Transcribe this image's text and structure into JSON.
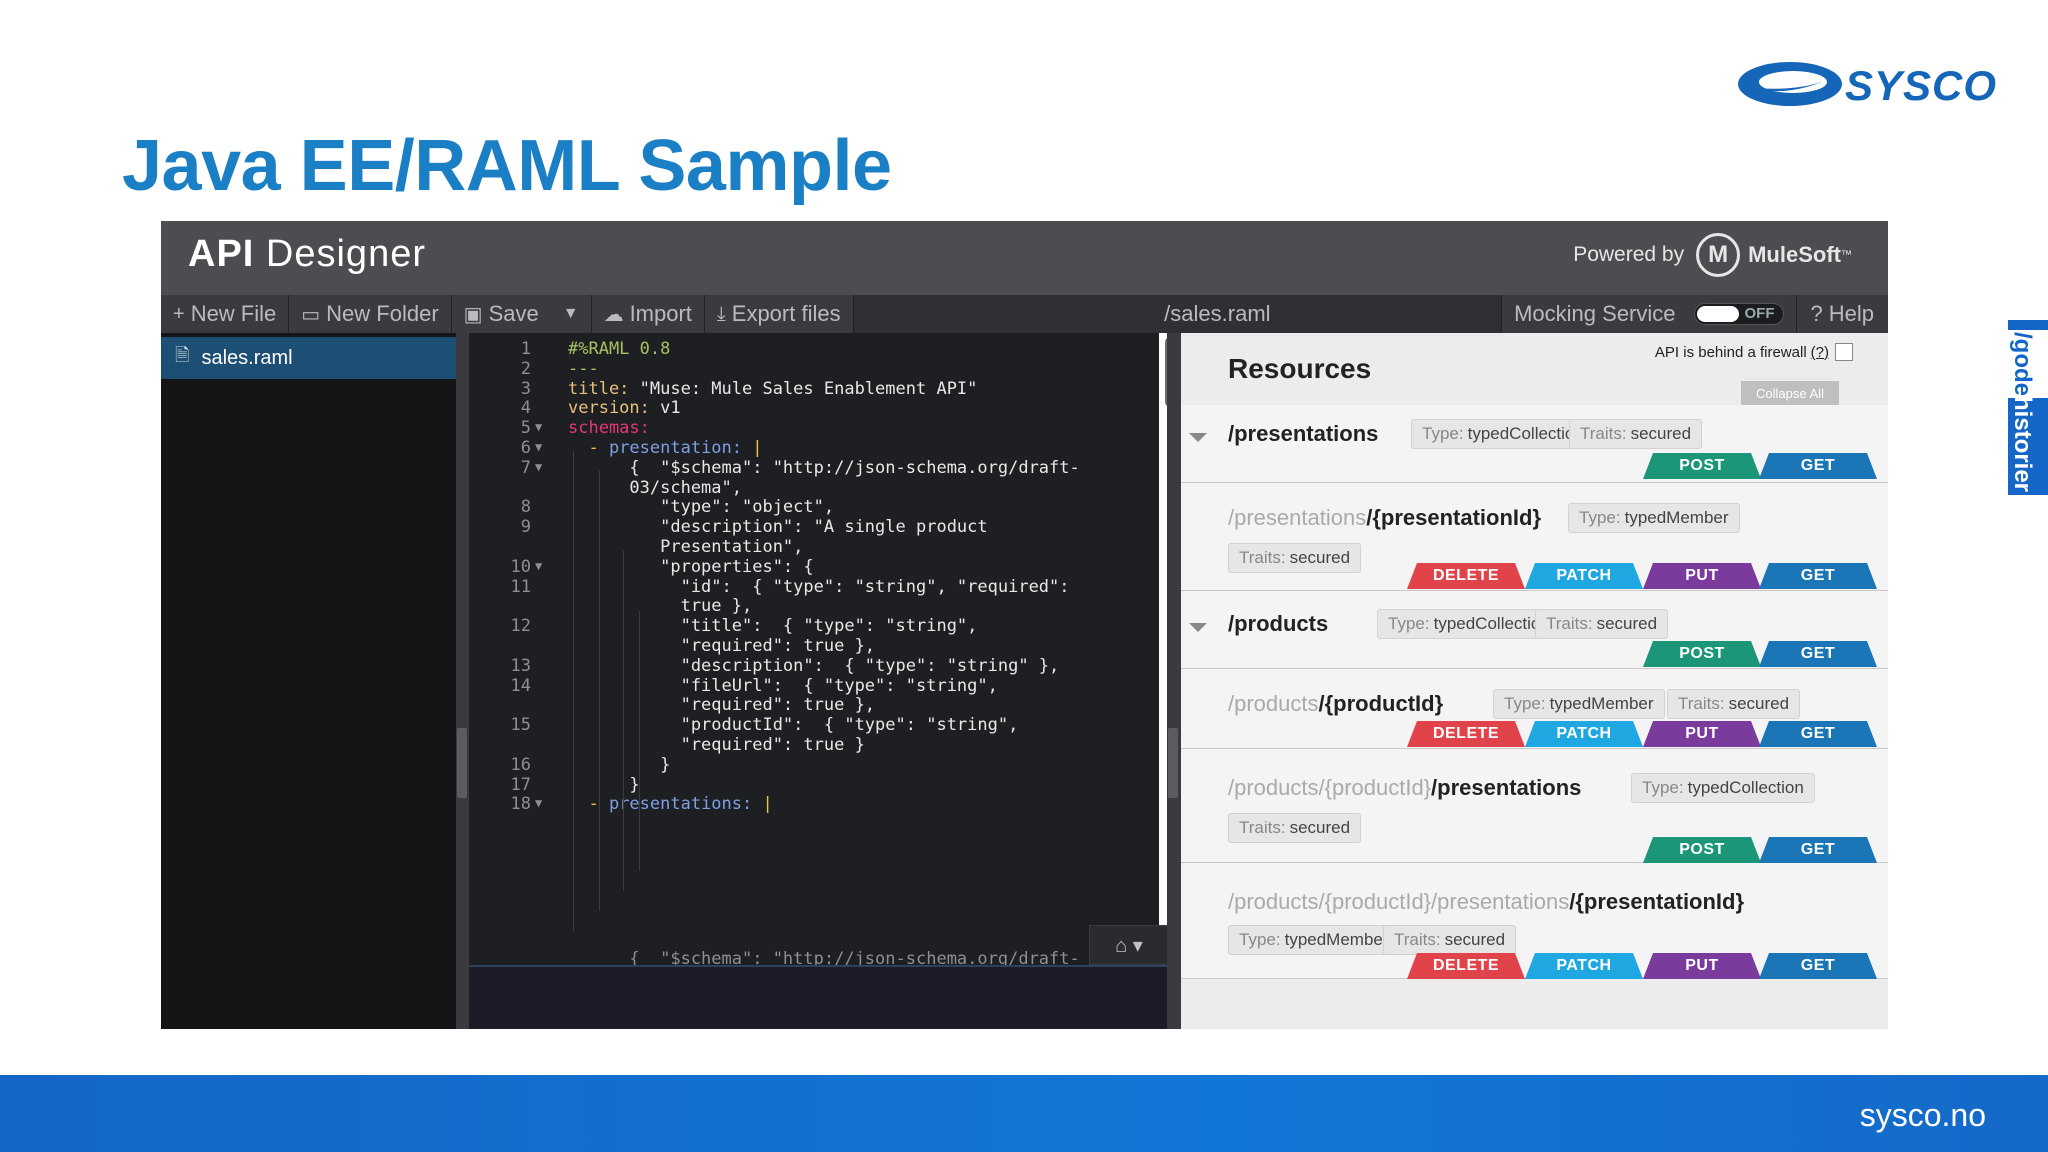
{
  "slide": {
    "title": "Java EE/RAML Sample",
    "logo_text": "SYSCO",
    "footer_url": "sysco.no",
    "side_tab": {
      "part1": "/gode",
      "part2": "historier"
    }
  },
  "app": {
    "title_bold": "API",
    "title_rest": " Designer",
    "powered_by": "Powered by",
    "brand": "MuleSoft",
    "brand_tm": "™"
  },
  "toolbar": {
    "new_file": "New File",
    "new_folder": "New Folder",
    "save": "Save",
    "import": "Import",
    "export": "Export files",
    "path": "/sales.raml",
    "mocking": "Mocking Service",
    "toggle": "OFF",
    "help": "Help"
  },
  "files": [
    {
      "name": "sales.raml"
    }
  ],
  "editor": {
    "lines": [
      {
        "n": "1",
        "fold": "",
        "parts": [
          [
            "meta",
            "#%RAML 0.8"
          ]
        ]
      },
      {
        "n": "2",
        "fold": "",
        "parts": [
          [
            "meta",
            "---"
          ]
        ]
      },
      {
        "n": "3",
        "fold": "",
        "parts": [
          [
            "key",
            "title: "
          ],
          [
            "str",
            "\"Muse: Mule Sales Enablement API\""
          ]
        ]
      },
      {
        "n": "4",
        "fold": "",
        "parts": [
          [
            "key",
            "version: "
          ],
          [
            "str",
            "v1"
          ]
        ]
      },
      {
        "n": "5",
        "fold": "▼",
        "parts": [
          [
            "pink",
            "schemas:"
          ]
        ]
      },
      {
        "n": "6",
        "fold": "▼",
        "parts": [
          [
            "bar",
            "  - "
          ],
          [
            "blue",
            "presentation: "
          ],
          [
            "bar",
            "|"
          ]
        ]
      },
      {
        "n": "7",
        "fold": "▼",
        "parts": [
          [
            "str",
            "      {  \"$schema\": \"http://json-schema.org/draft-"
          ]
        ]
      },
      {
        "n": "",
        "fold": "",
        "parts": [
          [
            "str",
            "      03/schema\","
          ]
        ]
      },
      {
        "n": "8",
        "fold": "",
        "parts": [
          [
            "str",
            "         \"type\": \"object\","
          ]
        ]
      },
      {
        "n": "9",
        "fold": "",
        "parts": [
          [
            "str",
            "         \"description\": \"A single product"
          ]
        ]
      },
      {
        "n": "",
        "fold": "",
        "parts": [
          [
            "str",
            "         Presentation\","
          ]
        ]
      },
      {
        "n": "10",
        "fold": "▼",
        "parts": [
          [
            "str",
            "         \"properties\": {"
          ]
        ]
      },
      {
        "n": "11",
        "fold": "",
        "parts": [
          [
            "str",
            "           \"id\":  { \"type\": \"string\", \"required\":"
          ]
        ]
      },
      {
        "n": "",
        "fold": "",
        "parts": [
          [
            "str",
            "           true },"
          ]
        ]
      },
      {
        "n": "12",
        "fold": "",
        "parts": [
          [
            "str",
            "           \"title\":  { \"type\": \"string\","
          ]
        ]
      },
      {
        "n": "",
        "fold": "",
        "parts": [
          [
            "str",
            "           \"required\": true },"
          ]
        ]
      },
      {
        "n": "13",
        "fold": "",
        "parts": [
          [
            "str",
            "           \"description\":  { \"type\": \"string\" },"
          ]
        ]
      },
      {
        "n": "14",
        "fold": "",
        "parts": [
          [
            "str",
            "           \"fileUrl\":  { \"type\": \"string\","
          ]
        ]
      },
      {
        "n": "",
        "fold": "",
        "parts": [
          [
            "str",
            "           \"required\": true },"
          ]
        ]
      },
      {
        "n": "15",
        "fold": "",
        "parts": [
          [
            "str",
            "           \"productId\":  { \"type\": \"string\","
          ]
        ]
      },
      {
        "n": "",
        "fold": "",
        "parts": [
          [
            "str",
            "           \"required\": true }"
          ]
        ]
      },
      {
        "n": "16",
        "fold": "",
        "parts": [
          [
            "str",
            "         }"
          ]
        ]
      },
      {
        "n": "17",
        "fold": "",
        "parts": [
          [
            "str",
            "      }"
          ]
        ]
      },
      {
        "n": "18",
        "fold": "▼",
        "parts": [
          [
            "bar",
            "  - "
          ],
          [
            "blue",
            "presentations: "
          ],
          [
            "bar",
            "|"
          ]
        ]
      }
    ],
    "cut_line": "      {  \"$schema\": \"http://json-schema.org/draft-"
  },
  "resources": {
    "title": "Resources",
    "firewall": "API is behind a firewall",
    "firewall_help": "(?)",
    "collapse_all": "Collapse All",
    "type_label": "Type:",
    "traits_label": "Traits:",
    "items": [
      {
        "dim": "",
        "path": "/presentations",
        "type": "typedCollection",
        "traits": "secured",
        "methods": [
          "POST",
          "GET"
        ]
      },
      {
        "dim": "/presentations",
        "path": "/{presentationId}",
        "type": "typedMember",
        "traits": "secured",
        "methods": [
          "DELETE",
          "PATCH",
          "PUT",
          "GET"
        ]
      },
      {
        "dim": "",
        "path": "/products",
        "type": "typedCollection",
        "traits": "secured",
        "methods": [
          "POST",
          "GET"
        ]
      },
      {
        "dim": "/products",
        "path": "/{productId}",
        "type": "typedMember",
        "traits": "secured",
        "methods": [
          "DELETE",
          "PATCH",
          "PUT",
          "GET"
        ]
      },
      {
        "dim": "/products/{productId}",
        "path": "/presentations",
        "type": "typedCollection",
        "traits": "secured",
        "methods": [
          "POST",
          "GET"
        ]
      },
      {
        "dim": "/products/{productId}/presentations",
        "path": "/{presentationId}",
        "type": "typedMember",
        "traits": "secured",
        "methods": [
          "DELETE",
          "PATCH",
          "PUT",
          "GET"
        ]
      }
    ]
  }
}
